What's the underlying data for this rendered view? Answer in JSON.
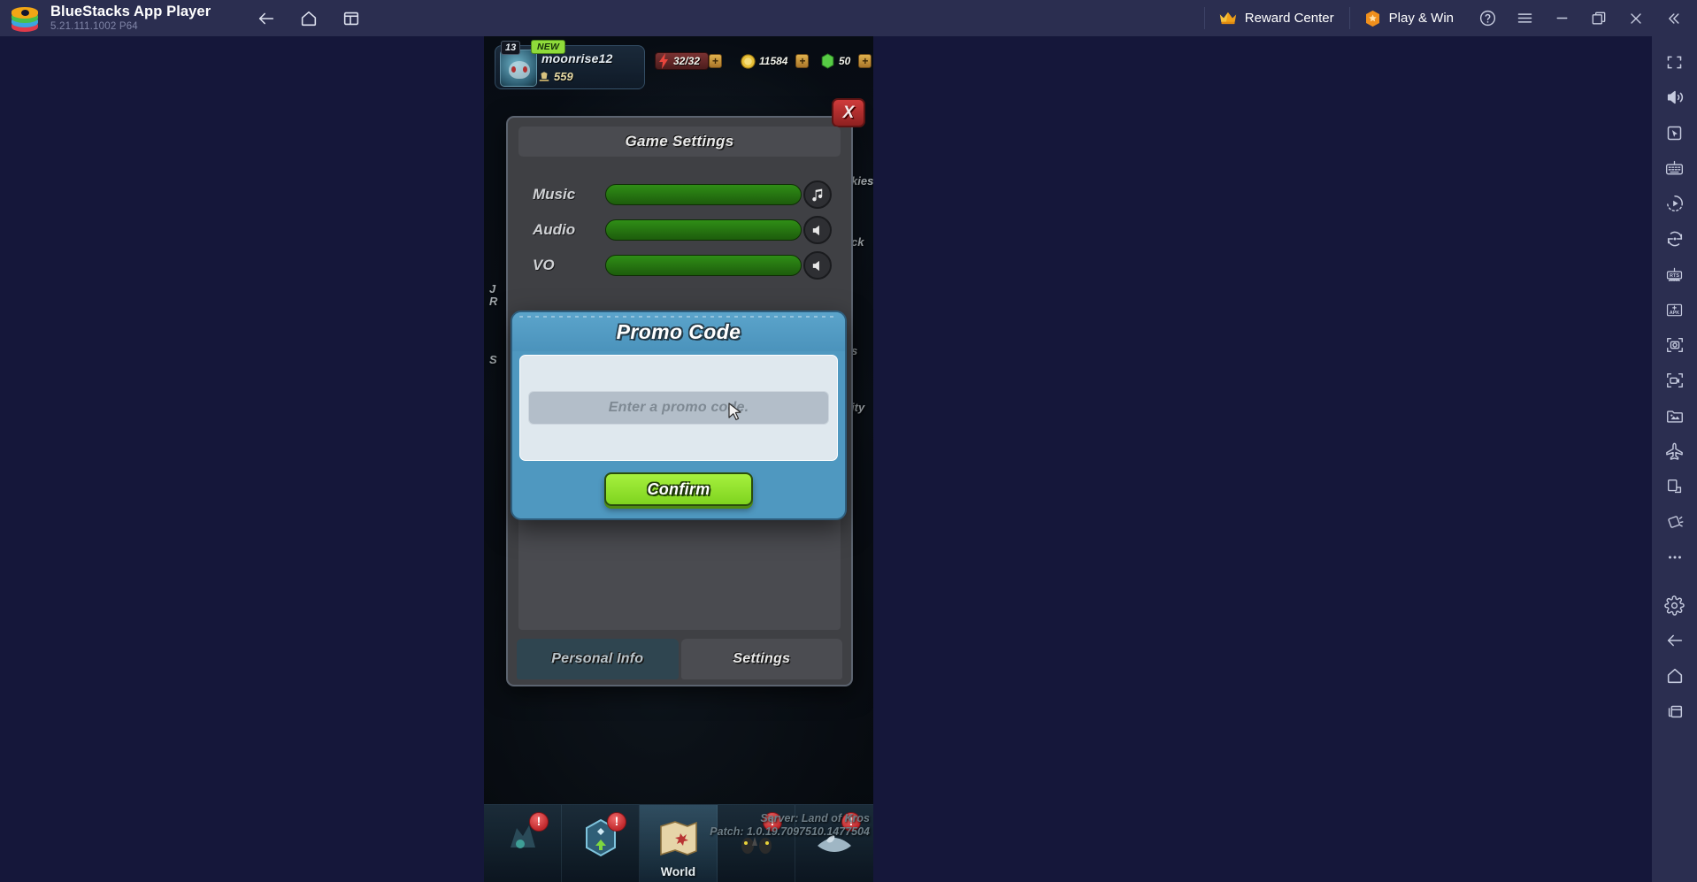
{
  "titlebar": {
    "app_title": "BlueStacks App Player",
    "version": "5.21.111.1002  P64",
    "logo_icon": "bluestacks-logo-icon",
    "nav": [
      {
        "name": "back",
        "icon": "arrow-left-icon"
      },
      {
        "name": "home",
        "icon": "home-icon"
      },
      {
        "name": "recents",
        "icon": "multi-window-icon"
      }
    ],
    "reward_center": {
      "label": "Reward Center",
      "icon": "crown-icon"
    },
    "play_and_win": {
      "label": "Play & Win",
      "icon": "hexagon-star-icon"
    },
    "controls": [
      {
        "name": "help",
        "icon": "question-circle-icon"
      },
      {
        "name": "menu",
        "icon": "hamburger-menu-icon"
      },
      {
        "name": "minimize",
        "icon": "minimize-icon"
      },
      {
        "name": "maximize",
        "icon": "maximize-restore-icon"
      },
      {
        "name": "close",
        "icon": "close-icon"
      },
      {
        "name": "collapse",
        "icon": "chevron-double-left-icon"
      }
    ]
  },
  "sidebar": {
    "items": [
      {
        "name": "fullscreen",
        "icon": "fullscreen-icon"
      },
      {
        "name": "volume",
        "icon": "volume-icon"
      },
      {
        "name": "game-controls",
        "icon": "cursor-box-icon"
      },
      {
        "name": "keymapping",
        "icon": "keyboard-icon"
      },
      {
        "name": "macro",
        "icon": "macro-play-icon"
      },
      {
        "name": "rotate",
        "icon": "rotate-icon"
      },
      {
        "name": "rts-mode",
        "icon": "rts-mode-icon"
      },
      {
        "name": "install-apk",
        "icon": "apk-install-icon"
      },
      {
        "name": "screenshot",
        "icon": "screenshot-icon"
      },
      {
        "name": "record-screen",
        "icon": "video-record-icon"
      },
      {
        "name": "media-manager",
        "icon": "media-gallery-icon"
      },
      {
        "name": "eco-mode",
        "icon": "airplane-icon"
      },
      {
        "name": "multi-instance",
        "icon": "multi-instance-icon"
      },
      {
        "name": "shake",
        "icon": "shake-icon"
      },
      {
        "name": "more",
        "icon": "ellipsis-icon"
      },
      {
        "name": "settings",
        "icon": "gear-icon"
      },
      {
        "name": "android-back",
        "icon": "arrow-left-icon"
      },
      {
        "name": "android-home",
        "icon": "home-icon"
      },
      {
        "name": "android-recents",
        "icon": "recents-icon"
      }
    ]
  },
  "game": {
    "hud": {
      "level": "13",
      "new_badge": "NEW",
      "username": "moonrise12",
      "power": "559",
      "energy": "32/32",
      "gold": "11584",
      "gems": "50",
      "plus": "+",
      "energy_icon": "lightning-icon",
      "gold_icon": "coin-icon",
      "gem_icon": "gem-icon",
      "power_icon": "power-icon",
      "avatar_icon": "avatar"
    },
    "settings_panel": {
      "title": "Game Settings",
      "close_label": "X",
      "rows": [
        {
          "label": "Music",
          "icon": "music-note-icon",
          "value": 100
        },
        {
          "label": "Audio",
          "icon": "speaker-icon",
          "value": 100
        },
        {
          "label": "VO",
          "icon": "speaker-icon",
          "value": 100
        }
      ],
      "tabs": [
        {
          "label": "Personal Info",
          "active": false
        },
        {
          "label": "Settings",
          "active": true
        }
      ],
      "clipped_text": [
        "kies",
        "ck",
        "s",
        "ity"
      ]
    },
    "promo_modal": {
      "title": "Promo Code",
      "input_placeholder": "Enter a promo code.",
      "input_value": "",
      "confirm_label": "Confirm"
    },
    "bottom_nav": [
      {
        "label": "",
        "icon": "alchemy-icon",
        "badge": "!"
      },
      {
        "label": "",
        "icon": "upgrade-gem-icon",
        "badge": "!"
      },
      {
        "label": "World",
        "icon": "map-icon",
        "badge": ""
      },
      {
        "label": "",
        "icon": "characters-icon",
        "badge": "!"
      },
      {
        "label": "",
        "icon": "shop-icon",
        "badge": "!"
      }
    ],
    "server_overlay": {
      "server": "Server: Land of Kros",
      "patch": "Patch: 1.0.19.7097510.1477504"
    }
  },
  "colors": {
    "titlebar_bg": "#2b2e50",
    "desktop_bg": "#15173a",
    "accent_orange": "#f08f1c",
    "promo_blue": "#4f98c0",
    "confirm_green": "#8fe03a",
    "close_red": "#c0282c",
    "slider_green": "#2f8e16"
  }
}
